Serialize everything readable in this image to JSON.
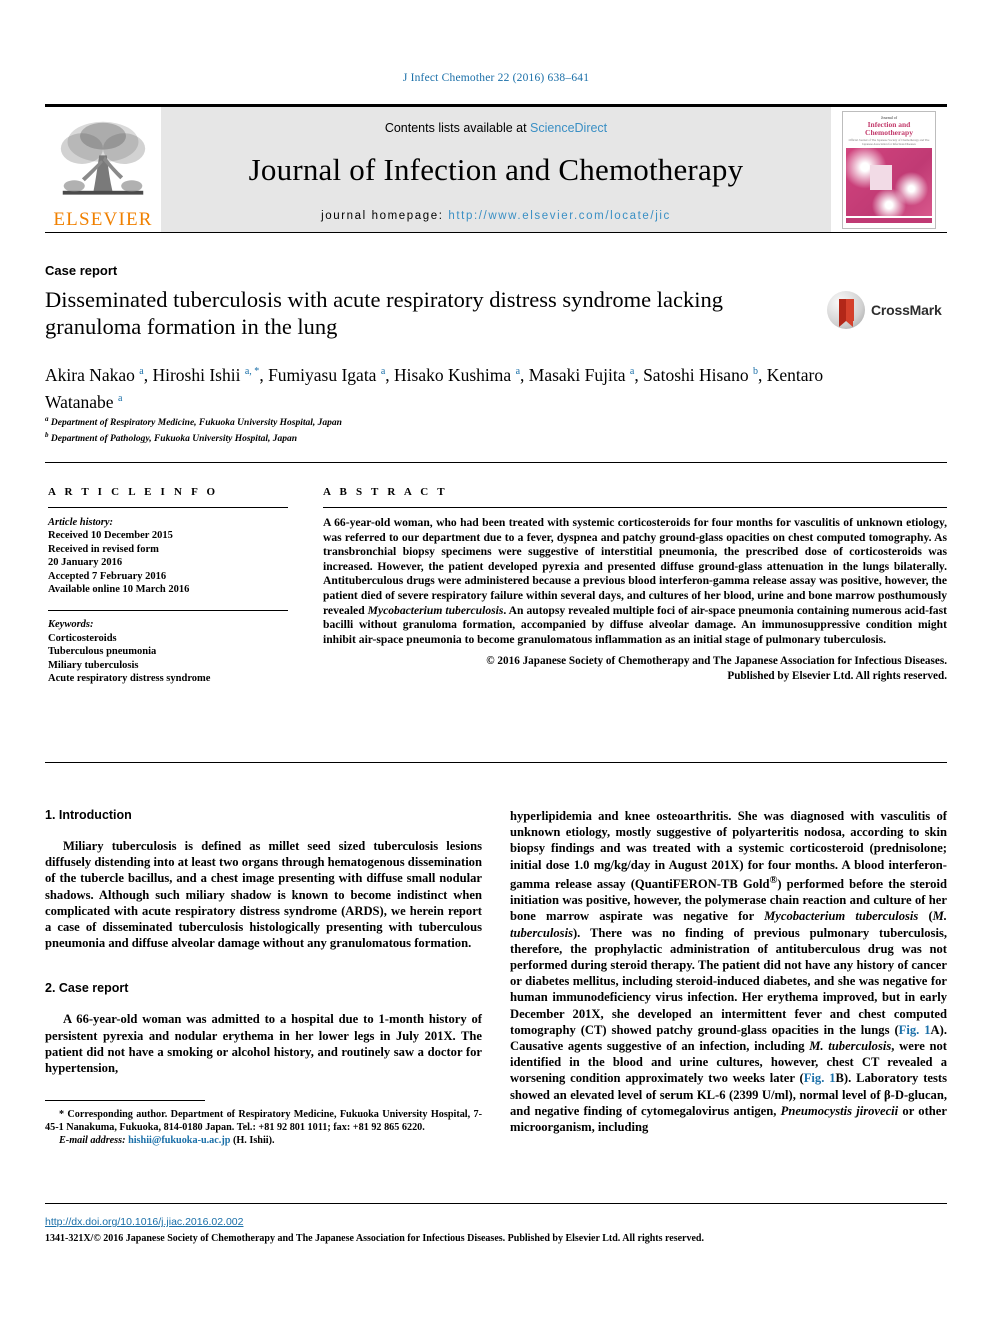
{
  "running_head": "J Infect Chemother 22 (2016) 638–641",
  "masthead": {
    "contents_prefix": "Contents lists available at ",
    "sciencedirect": "ScienceDirect",
    "journal_title": "Journal of Infection and Chemotherapy",
    "homepage_label": "journal homepage:",
    "homepage_url": "http://www.elsevier.com/locate/jic",
    "publisher_logo": "ELSEVIER",
    "publisher_logo_icon": "elsevier-tree-icon",
    "cover": {
      "top_line": "Journal of",
      "title": "Infection and Chemotherapy",
      "subtitle": "Official Journal of The Japanese Society of Chemotherapy and The Japanese Association for Infectious Diseases"
    }
  },
  "article": {
    "type": "Case report",
    "title": "Disseminated tuberculosis with acute respiratory distress syndrome lacking granuloma formation in the lung",
    "crossmark_label": "CrossMark",
    "authors_html": "Akira Nakao <sup>a</sup>, Hiroshi Ishii <sup>a, *</sup>, Fumiyasu Igata <sup>a</sup>, Hisako Kushima <sup>a</sup>, Masaki Fujita <sup>a</sup>, Satoshi Hisano <sup>b</sup>, Kentaro Watanabe <sup>a</sup>",
    "affiliations_html": "<sup>a</sup> Department of Respiratory Medicine, Fukuoka University Hospital, Japan<br><sup>b</sup> Department of Pathology, Fukuoka University Hospital, Japan"
  },
  "article_info": {
    "heading": "A R T I C L E  I N F O",
    "history_label": "Article history:",
    "history": [
      "Received 10 December 2015",
      "Received in revised form",
      "20 January 2016",
      "Accepted 7 February 2016",
      "Available online 10 March 2016"
    ],
    "keywords_label": "Keywords:",
    "keywords": [
      "Corticosteroids",
      "Tuberculous pneumonia",
      "Miliary tuberculosis",
      "Acute respiratory distress syndrome"
    ]
  },
  "abstract": {
    "heading": "A B S T R A C T",
    "body_html": "A 66-year-old woman, who had been treated with systemic corticosteroids for four months for vasculitis of unknown etiology, was referred to our department due to a fever, dyspnea and patchy ground-glass opacities on chest computed tomography. As transbronchial biopsy specimens were suggestive of interstitial pneumonia, the prescribed dose of corticosteroids was increased. However, the patient developed pyrexia and presented diffuse ground-glass attenuation in the lungs bilaterally. Antituberculous drugs were administered because a previous blood interferon-gamma release assay was positive, however, the patient died of severe respiratory failure within several days, and cultures of her blood, urine and bone marrow posthumously revealed <i>Mycobacterium tuberculosis</i>. An autopsy revealed multiple foci of air-space pneumonia containing numerous acid-fast bacilli without granuloma formation, accompanied by diffuse alveolar damage. An immunosuppressive condition might inhibit air-space pneumonia to become granulomatous inflammation as an initial stage of pulmonary tuberculosis.",
    "copyright_html": "© 2016 Japanese Society of Chemotherapy and The Japanese Association for Infectious Diseases.<br>Published by Elsevier Ltd. All rights reserved."
  },
  "body": {
    "section1_heading": "1. Introduction",
    "section1_para": "Miliary tuberculosis is defined as millet seed sized tuberculosis lesions diffusely distending into at least two organs through hematogenous dissemination of the tubercle bacillus, and a chest image presenting with diffuse small nodular shadows. Although such miliary shadow is known to become indistinct when complicated with acute respiratory distress syndrome (ARDS), we herein report a case of disseminated tuberculosis histologically presenting with tuberculous pneumonia and diffuse alveolar damage without any granulomatous formation.",
    "section2_heading": "2. Case report",
    "section2_para": "A 66-year-old woman was admitted to a hospital due to 1-month history of persistent pyrexia and nodular erythema in her lower legs in July 201X. The patient did not have a smoking or alcohol history, and routinely saw a doctor for hypertension,",
    "right_para_html": "hyperlipidemia and knee osteoarthritis. She was diagnosed with vasculitis of unknown etiology, mostly suggestive of polyarteritis nodosa, according to skin biopsy findings and was treated with a systemic corticosteroid (prednisolone; initial dose 1.0 mg/kg/day in August 201X) for four months. A blood interferon-gamma release assay (QuantiFERON-TB Gold<sup>®</sup>) performed before the steroid initiation was positive, however, the polymerase chain reaction and culture of her bone marrow aspirate was negative for <i>Mycobacterium tuberculosis</i> (<i>M. tuberculosis</i>). There was no finding of previous pulmonary tuberculosis, therefore, the prophylactic administration of antituberculous drug was not performed during steroid therapy. The patient did not have any history of cancer or diabetes mellitus, including steroid-induced diabetes, and she was negative for human immunodeficiency virus infection. Her erythema improved, but in early December 201X, she developed an intermittent fever and chest computed tomography (CT) showed patchy ground-glass opacities in the lungs (<span class=\"lnk\">Fig. 1</span>A). Causative agents suggestive of an infection, including <i>M. tuberculosis</i>, were not identified in the blood and urine cultures, however, chest CT revealed a worsening condition approximately two weeks later (<span class=\"lnk\">Fig. 1</span>B). Laboratory tests showed an elevated level of serum KL-6 (2399 U/ml), normal level of β-D-glucan, and negative finding of cytomegalovirus antigen, <i>Pneumocystis jirovecii</i> or other microorganism, including"
  },
  "footnote": {
    "corresponding_html": "* Corresponding author. Department of Respiratory Medicine, Fukuoka University Hospital, 7-45-1 Nanakuma, Fukuoka, 814-0180 Japan. Tel.: +81 92 801 1011; fax: +81 92 865 6220.",
    "email_label": "E-mail address:",
    "email": "hishii@fukuoka-u.ac.jp",
    "email_suffix": "(H. Ishii)."
  },
  "footer": {
    "doi": "http://dx.doi.org/10.1016/j.jiac.2016.02.002",
    "copyright": "1341-321X/© 2016 Japanese Society of Chemotherapy and The Japanese Association for Infectious Diseases. Published by Elsevier Ltd. All rights reserved."
  },
  "colors": {
    "link_blue": "#1a6fa8",
    "sciencedirect_blue": "#3a8fc4",
    "elsevier_orange": "#f08000",
    "cover_pink": "#c03a74"
  }
}
